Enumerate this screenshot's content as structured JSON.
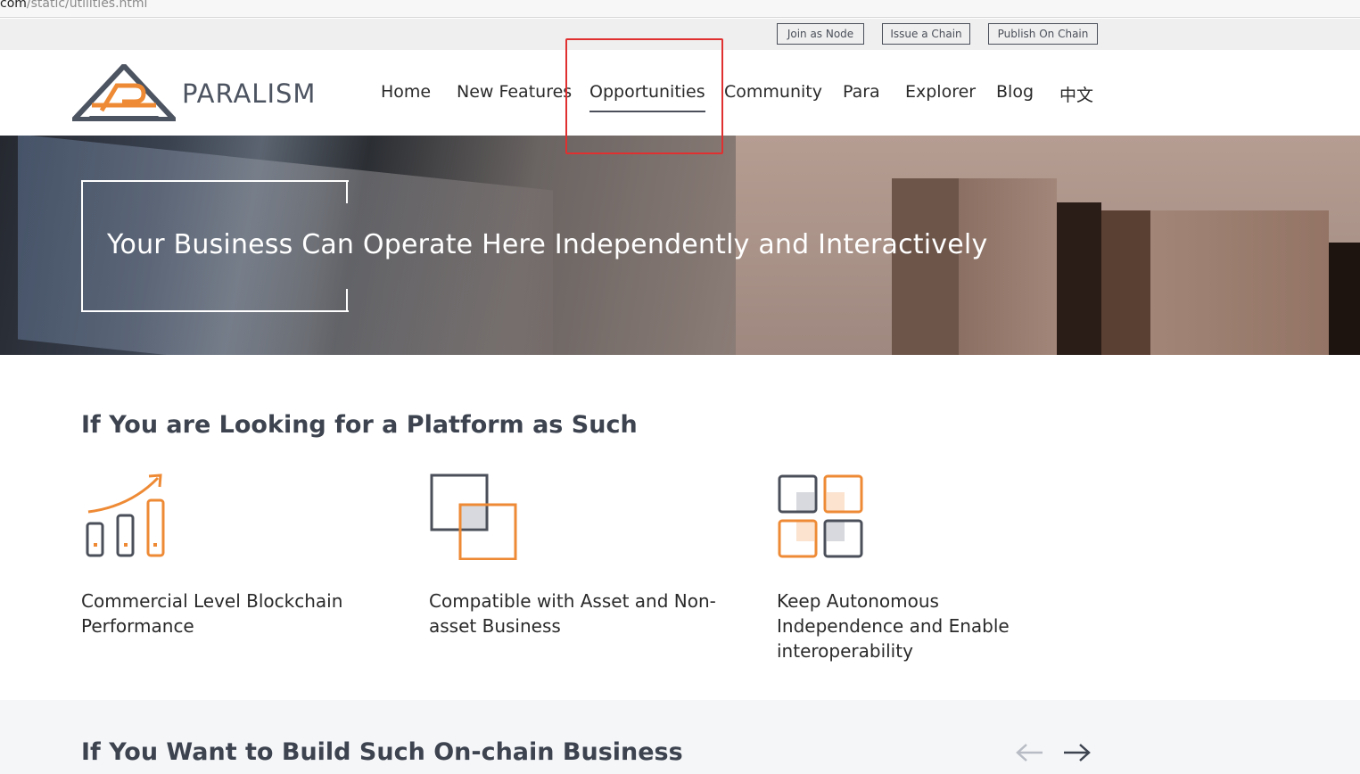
{
  "browser": {
    "url_host": "com",
    "url_path": "/static/utilities.html"
  },
  "topbar": {
    "buttons": [
      {
        "label": "Join as Node"
      },
      {
        "label": "Issue a Chain"
      },
      {
        "label": "Publish On Chain"
      }
    ]
  },
  "header": {
    "logo_text": "PARALISM",
    "nav": [
      {
        "label": "Home"
      },
      {
        "label": "New Features"
      },
      {
        "label": "Opportunities",
        "active": true
      },
      {
        "label": "Community"
      },
      {
        "label": "Para"
      },
      {
        "label": "Explorer"
      },
      {
        "label": "Blog"
      },
      {
        "label": "中文"
      }
    ]
  },
  "hero": {
    "title": "Your Business Can Operate Here Independently and Interactively"
  },
  "section1": {
    "title": "If You are Looking for a Platform as Such",
    "features": [
      {
        "icon": "bar-chart-growth-icon",
        "text": "Commercial Level Blockchain Performance"
      },
      {
        "icon": "overlapping-squares-icon",
        "text": "Compatible with Asset and Non-asset Business"
      },
      {
        "icon": "grid-squares-icon",
        "text": "Keep Autonomous Independence and Enable interoperability"
      }
    ]
  },
  "section2": {
    "title": "If You Want to Build Such On-chain Business",
    "prev_icon": "arrow-left-icon",
    "next_icon": "arrow-right-icon"
  },
  "colors": {
    "accent_orange": "#ee8a35",
    "slate": "#4a4f59",
    "highlight_red": "#e03030"
  }
}
